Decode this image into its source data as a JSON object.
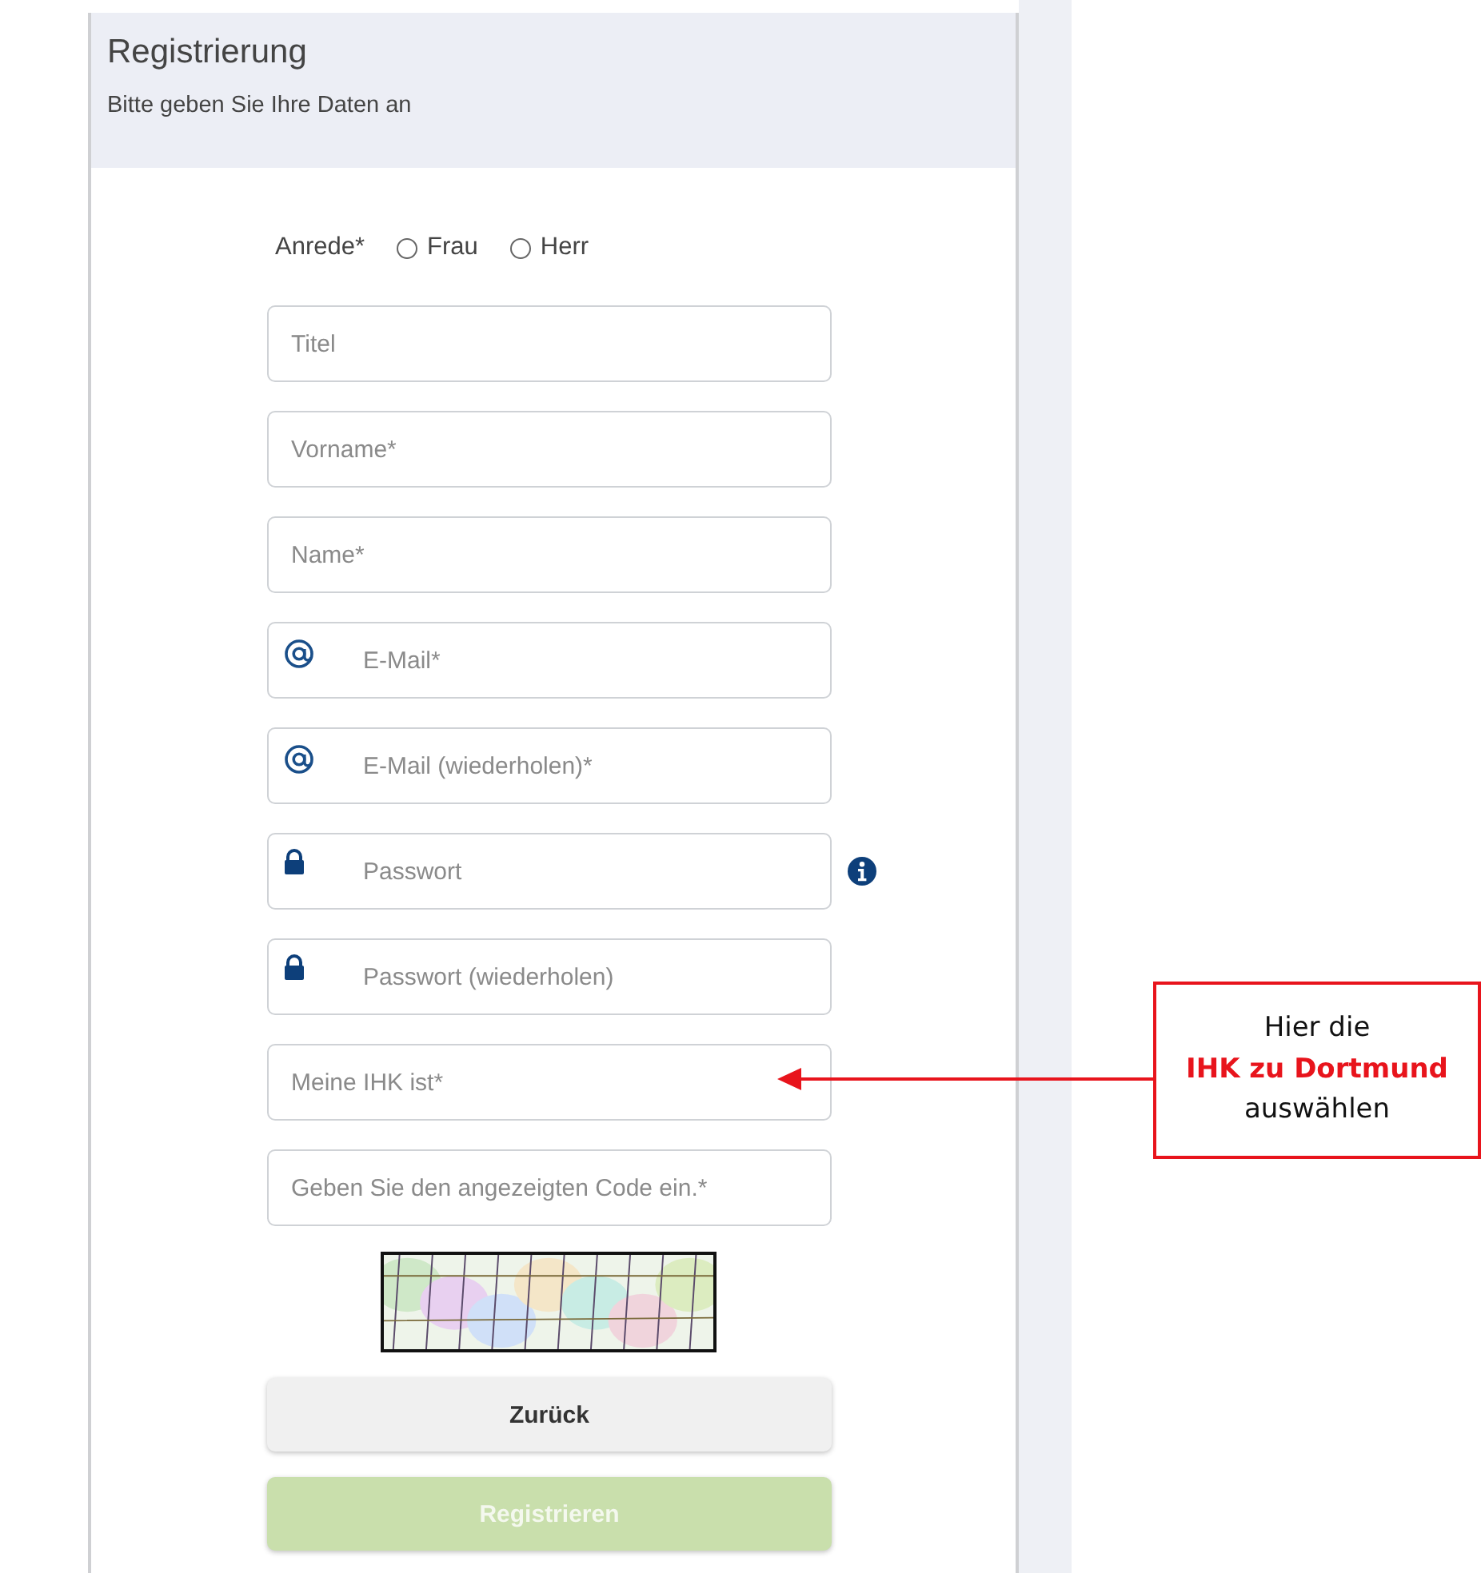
{
  "header": {
    "title": "Registrierung",
    "subtitle": "Bitte geben Sie Ihre Daten an"
  },
  "salutation": {
    "label": "Anrede*",
    "options": [
      {
        "label": "Frau",
        "selected": false
      },
      {
        "label": "Herr",
        "selected": false
      }
    ]
  },
  "fields": [
    {
      "placeholder": "Titel",
      "kind": "plain",
      "info": false
    },
    {
      "placeholder": "Vorname*",
      "kind": "plain",
      "info": false
    },
    {
      "placeholder": "Name*",
      "kind": "plain",
      "info": false
    },
    {
      "placeholder": "E-Mail*",
      "kind": "email",
      "info": false
    },
    {
      "placeholder": "E-Mail (wiederholen)*",
      "kind": "email",
      "info": false
    },
    {
      "placeholder": "Passwort",
      "kind": "password",
      "info": true
    },
    {
      "placeholder": "Passwort (wiederholen)",
      "kind": "password",
      "info": false
    },
    {
      "placeholder": "Meine IHK ist*",
      "kind": "plain",
      "info": false
    },
    {
      "placeholder": "Geben Sie den angezeigten Code ein.*",
      "kind": "plain",
      "info": false
    }
  ],
  "buttons": [
    {
      "label": "Zurück",
      "kind": "secondary",
      "disabled": false
    },
    {
      "label": "Registrieren",
      "kind": "primary",
      "disabled": true
    }
  ],
  "callout": {
    "text": "Hier die **IHK zu Dortmund** auswählen"
  }
}
